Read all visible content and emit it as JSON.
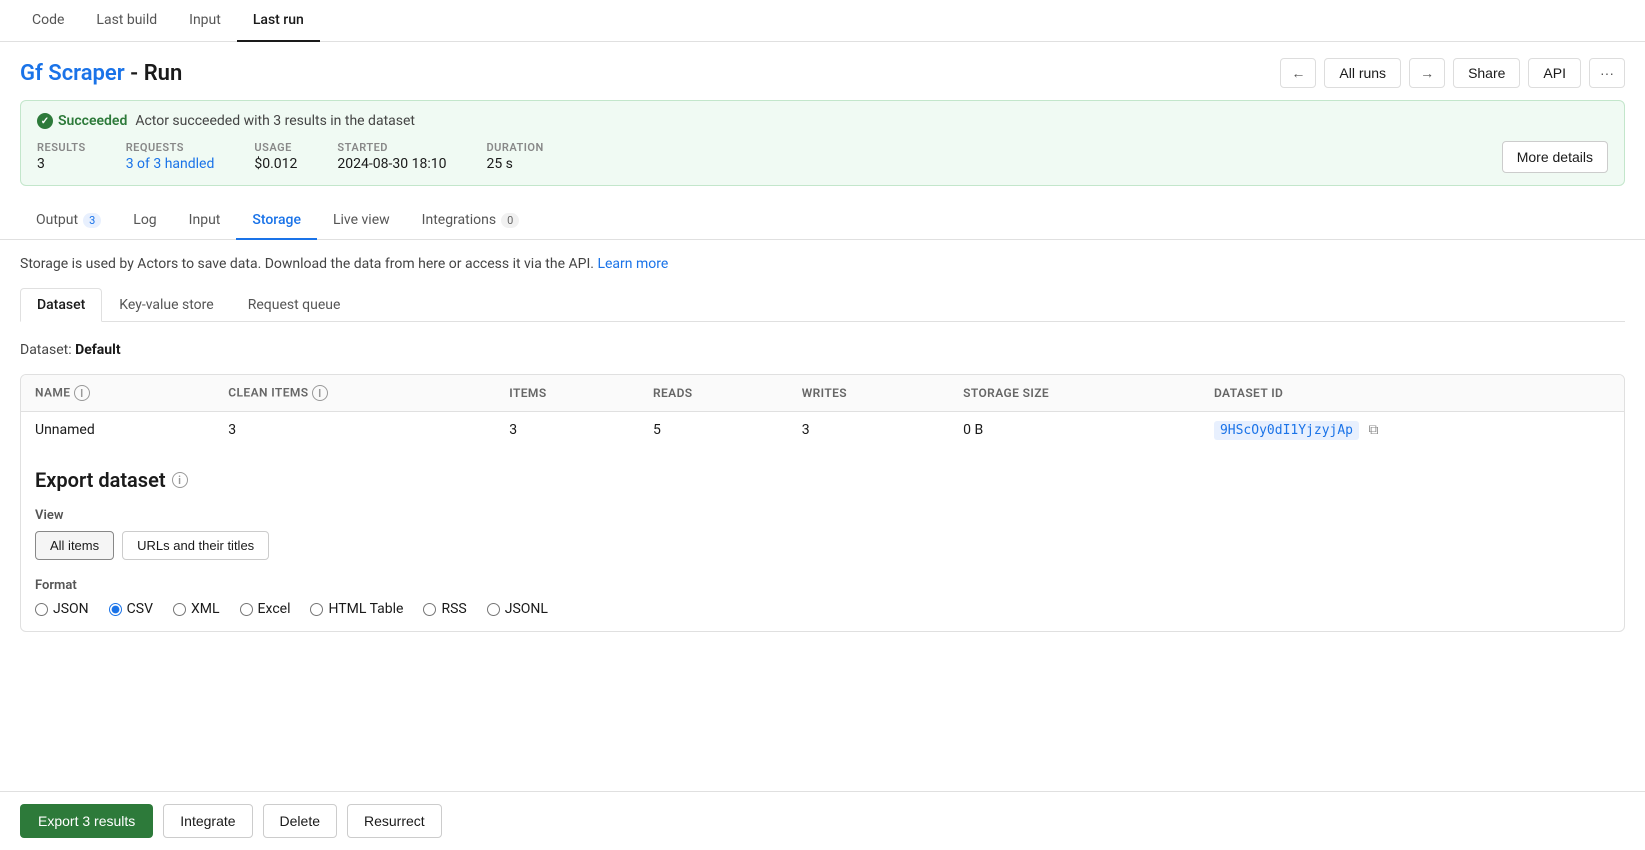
{
  "top_tabs": [
    {
      "id": "code",
      "label": "Code",
      "active": false
    },
    {
      "id": "last-build",
      "label": "Last build",
      "active": false
    },
    {
      "id": "input",
      "label": "Input",
      "active": false
    },
    {
      "id": "last-run",
      "label": "Last run",
      "active": true
    }
  ],
  "page_title": {
    "actor": "Gf Scraper",
    "separator": " - ",
    "run": "Run"
  },
  "header_actions": {
    "prev_label": "←",
    "all_runs_label": "All runs",
    "next_label": "→",
    "share_label": "Share",
    "api_label": "API",
    "more_label": "···"
  },
  "status": {
    "icon": "✓",
    "badge": "Succeeded",
    "message": "Actor succeeded with 3 results in the dataset"
  },
  "stats": [
    {
      "label": "RESULTS",
      "value": "3",
      "link": false
    },
    {
      "label": "REQUESTS",
      "value": "3 of 3 handled",
      "link": true
    },
    {
      "label": "USAGE",
      "value": "$0.012",
      "link": false
    },
    {
      "label": "STARTED",
      "value": "2024-08-30 18:10",
      "link": false
    },
    {
      "label": "DURATION",
      "value": "25 s",
      "link": false
    }
  ],
  "more_details_label": "More details",
  "sub_tabs": [
    {
      "id": "output",
      "label": "Output",
      "badge": "3",
      "badge_type": "blue",
      "active": false
    },
    {
      "id": "log",
      "label": "Log",
      "badge": null,
      "active": false
    },
    {
      "id": "input",
      "label": "Input",
      "badge": null,
      "active": false
    },
    {
      "id": "storage",
      "label": "Storage",
      "badge": null,
      "active": true
    },
    {
      "id": "live-view",
      "label": "Live view",
      "badge": null,
      "active": false
    },
    {
      "id": "integrations",
      "label": "Integrations",
      "badge": "0",
      "badge_type": "neutral",
      "active": false
    }
  ],
  "storage_desc": "Storage is used by Actors to save data. Download the data from here or access it via the API.",
  "learn_more_label": "Learn more",
  "storage_tabs": [
    {
      "id": "dataset",
      "label": "Dataset",
      "active": true
    },
    {
      "id": "key-value",
      "label": "Key-value store",
      "active": false
    },
    {
      "id": "request-queue",
      "label": "Request queue",
      "active": false
    }
  ],
  "dataset_label": "Dataset:",
  "dataset_name": "Default",
  "table": {
    "columns": [
      {
        "id": "name",
        "label": "NAME",
        "has_info": true
      },
      {
        "id": "clean-items",
        "label": "CLEAN ITEMS",
        "has_info": true
      },
      {
        "id": "items",
        "label": "ITEMS",
        "has_info": false
      },
      {
        "id": "reads",
        "label": "READS",
        "has_info": false
      },
      {
        "id": "writes",
        "label": "WRITES",
        "has_info": false
      },
      {
        "id": "storage-size",
        "label": "STORAGE SIZE",
        "has_info": false
      },
      {
        "id": "dataset-id",
        "label": "DATASET ID",
        "has_info": false
      }
    ],
    "rows": [
      {
        "name": "Unnamed",
        "clean_items": "3",
        "items": "3",
        "reads": "5",
        "writes": "3",
        "storage_size": "0 B",
        "dataset_id": "9HScOy0dI1YjzyjAp"
      }
    ]
  },
  "export": {
    "title": "Export dataset",
    "view_label": "View",
    "views": [
      {
        "id": "all-items",
        "label": "All items",
        "active": true
      },
      {
        "id": "urls-titles",
        "label": "URLs and their titles",
        "active": false
      }
    ],
    "format_label": "Format",
    "formats": [
      {
        "id": "json",
        "label": "JSON",
        "selected": false
      },
      {
        "id": "csv",
        "label": "CSV",
        "selected": true
      },
      {
        "id": "xml",
        "label": "XML",
        "selected": false
      },
      {
        "id": "excel",
        "label": "Excel",
        "selected": false
      },
      {
        "id": "html-table",
        "label": "HTML Table",
        "selected": false
      },
      {
        "id": "rss",
        "label": "RSS",
        "selected": false
      },
      {
        "id": "jsonl",
        "label": "JSONL",
        "selected": false
      }
    ]
  },
  "bottom_bar": {
    "export_label": "Export 3 results",
    "integrate_label": "Integrate",
    "delete_label": "Delete",
    "resurrect_label": "Resurrect"
  }
}
